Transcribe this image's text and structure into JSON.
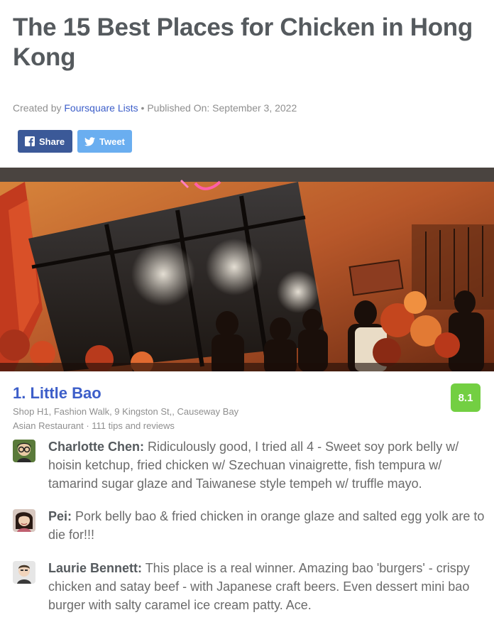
{
  "page": {
    "title": "The 15 Best Places for Chicken in Hong Kong",
    "created_by_prefix": "Created by ",
    "created_by_link": "Foursquare Lists",
    "published": " • Published On: September 3, 2022"
  },
  "share": {
    "facebook_label": "Share",
    "twitter_label": "Tweet"
  },
  "venue": {
    "rank_name": "1. Little Bao",
    "score": "8.1",
    "address": "Shop H1, Fashion Walk, 9 Kingston St,, Causeway Bay",
    "category": "Asian Restaurant · 111 tips and reviews"
  },
  "tips": [
    {
      "author": "Charlotte Chen:",
      "text": " Ridiculously good, I tried all 4 - Sweet soy pork belly w/ hoisin ketchup, fried chicken w/ Szechuan vinaigrette, fish tempura w/ tamarind sugar glaze and Taiwanese style tempeh w/ truffle mayo."
    },
    {
      "author": "Pei:",
      "text": " Pork belly bao & fried chicken in orange glaze and salted egg yolk are to die for!!!"
    },
    {
      "author": "Laurie Bennett:",
      "text": " This place is a real winner. Amazing bao 'burgers' - crispy chicken and satay beef - with Japanese craft beers. Even dessert mini bao burger with salty caramel ice cream patty. Ace."
    }
  ],
  "colors": {
    "link": "#3c5ec9",
    "score": "#73cf42",
    "facebook": "#3b5998",
    "twitter": "#6aaef0"
  },
  "icons": {
    "facebook": "facebook-icon",
    "twitter": "twitter-icon"
  }
}
